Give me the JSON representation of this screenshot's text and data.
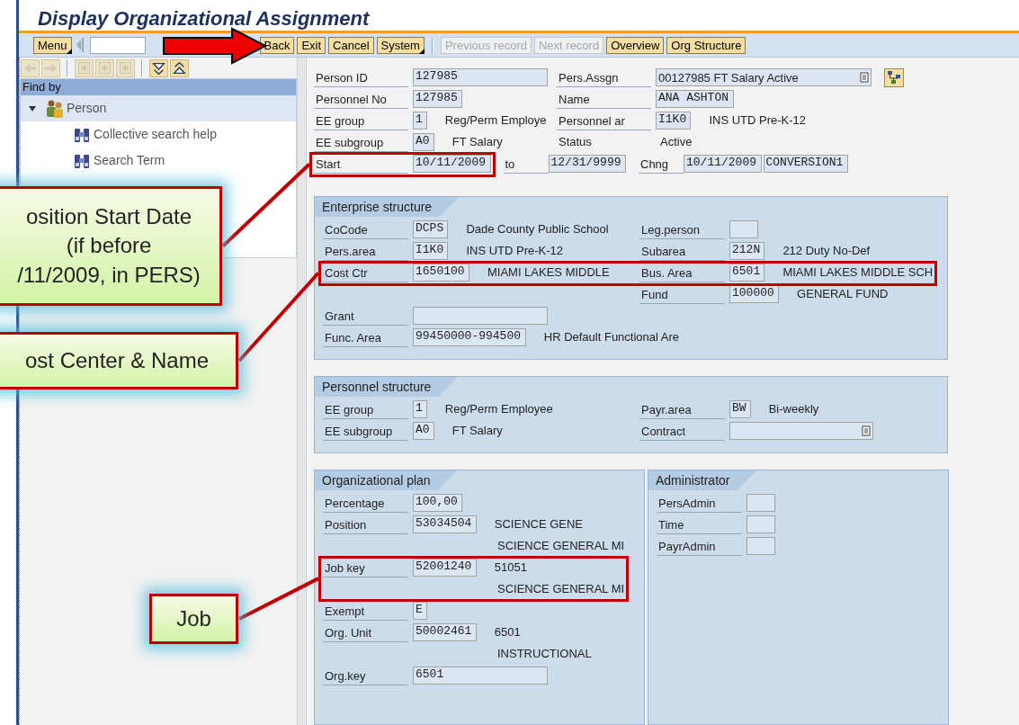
{
  "window": {
    "title": "Display Organizational Assignment"
  },
  "toolbar": {
    "menu": {
      "label": "Menu"
    },
    "button_groups": [
      [
        {
          "label": "Back",
          "kind": "button",
          "disabled": false
        },
        {
          "label": "Exit",
          "kind": "button",
          "disabled": false
        },
        {
          "label": "Cancel",
          "kind": "button",
          "disabled": false
        },
        {
          "label": "System",
          "kind": "menu",
          "disabled": false
        }
      ],
      [
        {
          "label": "Previous record",
          "kind": "button",
          "disabled": true
        },
        {
          "label": "Next record",
          "kind": "button",
          "disabled": true
        },
        {
          "label": "Overview",
          "kind": "button",
          "disabled": false
        },
        {
          "label": "Org Structure",
          "kind": "button",
          "disabled": false
        }
      ]
    ]
  },
  "nav_toolbar": [
    {
      "kind": "back",
      "disabled": true
    },
    {
      "kind": "forward",
      "disabled": true
    },
    {
      "kind": "grid",
      "disabled": true
    },
    {
      "kind": "grid",
      "disabled": true
    },
    {
      "kind": "grid",
      "disabled": true
    },
    {
      "kind": "expand",
      "disabled": false
    },
    {
      "kind": "collapse",
      "disabled": false
    }
  ],
  "find_by": {
    "header": "Find by",
    "items": [
      {
        "label": "Person",
        "expanded": true,
        "selected": true,
        "children": [
          {
            "label": "Collective search help",
            "selected": false
          },
          {
            "label": "Search Term",
            "selected": false
          }
        ]
      }
    ]
  },
  "header_rows": [
    {
      "left": [
        {
          "kind": "label",
          "text": "Person ID"
        },
        {
          "kind": "wide-field",
          "value": "127985"
        }
      ],
      "right": [
        {
          "kind": "label",
          "text": "Pers.Assgn"
        },
        {
          "kind": "dropdown",
          "value": "00127985 FT Salary Active"
        },
        {
          "kind": "org-button"
        }
      ]
    },
    {
      "left": [
        {
          "kind": "label",
          "text": "Personnel No"
        },
        {
          "kind": "field",
          "value": "127985"
        }
      ],
      "right": [
        {
          "kind": "label",
          "text": "Name"
        },
        {
          "kind": "field",
          "value": "ANA ASHTON"
        }
      ]
    },
    {
      "left": [
        {
          "kind": "label",
          "text": "EE group"
        },
        {
          "kind": "field",
          "value": "1"
        },
        {
          "kind": "text",
          "text": "Reg/Perm Employe"
        }
      ],
      "right": [
        {
          "kind": "label",
          "text": "Personnel ar"
        },
        {
          "kind": "field",
          "value": "I1K0"
        },
        {
          "kind": "text",
          "text": "INS UTD Pre-K-12"
        }
      ]
    },
    {
      "left": [
        {
          "kind": "label",
          "text": "EE subgroup"
        },
        {
          "kind": "field",
          "value": "A0"
        },
        {
          "kind": "text",
          "text": "FT Salary"
        }
      ],
      "right": [
        {
          "kind": "plain",
          "text": "Status"
        },
        {
          "kind": "text",
          "text": "Active"
        }
      ]
    },
    {
      "left": [
        {
          "kind": "label",
          "text": "Start",
          "highlighted": true
        },
        {
          "kind": "field",
          "value": "10/11/2009",
          "highlighted": true
        },
        {
          "kind": "short-label",
          "text": "to"
        },
        {
          "kind": "field",
          "value": "12/31/9999"
        }
      ],
      "right": [
        {
          "kind": "short-label",
          "text": "Chng"
        },
        {
          "kind": "field",
          "value": "10/11/2009"
        },
        {
          "kind": "field",
          "value": "CONVERSION1"
        }
      ]
    }
  ],
  "section_rows": [
    [
      {
        "title": "Enterprise structure",
        "rows": [
          {
            "left": [
              {
                "kind": "label",
                "text": "CoCode"
              },
              {
                "kind": "field",
                "value": "DCPS"
              },
              {
                "kind": "text",
                "text": "Dade County Public School"
              }
            ],
            "right": [
              {
                "kind": "label",
                "text": "Leg.person"
              },
              {
                "kind": "field"
              }
            ]
          },
          {
            "left": [
              {
                "kind": "label",
                "text": "Pers.area"
              },
              {
                "kind": "field",
                "value": "I1K0"
              },
              {
                "kind": "text",
                "text": "INS UTD Pre-K-12"
              }
            ],
            "right": [
              {
                "kind": "label",
                "text": "Subarea"
              },
              {
                "kind": "field",
                "value": "212N"
              },
              {
                "kind": "text",
                "text": "212 Duty No-Def"
              }
            ]
          },
          {
            "left": [
              {
                "kind": "label",
                "text": "Cost Ctr",
                "highlighted": true
              },
              {
                "kind": "field",
                "value": "1650100",
                "highlighted": true
              },
              {
                "kind": "text",
                "text": "MIAMI LAKES MIDDLE",
                "highlighted": true
              }
            ],
            "right": [
              {
                "kind": "label",
                "text": "Bus. Area",
                "highlighted": true
              },
              {
                "kind": "field",
                "value": "6501",
                "highlighted": true
              },
              {
                "kind": "text",
                "text": "MIAMI LAKES MIDDLE SCH",
                "highlighted": true
              }
            ]
          },
          {
            "right": [
              {
                "kind": "label",
                "text": "Fund"
              },
              {
                "kind": "field",
                "value": "100000"
              },
              {
                "kind": "text",
                "text": "GENERAL FUND"
              }
            ]
          },
          {
            "left": [
              {
                "kind": "label",
                "text": "Grant"
              },
              {
                "kind": "wide-field"
              }
            ]
          },
          {
            "left": [
              {
                "kind": "label",
                "text": "Func. Area"
              },
              {
                "kind": "field",
                "value": "99450000-994500"
              },
              {
                "kind": "text",
                "text": "HR Default Functional Are"
              }
            ]
          }
        ]
      }
    ],
    [
      {
        "title": "Personnel structure",
        "rows": [
          {
            "left": [
              {
                "kind": "label",
                "text": "EE group"
              },
              {
                "kind": "field",
                "value": "1"
              },
              {
                "kind": "text",
                "text": "Reg/Perm Employee"
              }
            ],
            "right": [
              {
                "kind": "label",
                "text": "Payr.area"
              },
              {
                "kind": "field",
                "value": "BW"
              },
              {
                "kind": "text",
                "text": "Bi-weekly"
              }
            ]
          },
          {
            "left": [
              {
                "kind": "label",
                "text": "EE subgroup"
              },
              {
                "kind": "field",
                "value": "A0"
              },
              {
                "kind": "text",
                "text": "FT Salary"
              }
            ],
            "right": [
              {
                "kind": "label",
                "text": "Contract"
              },
              {
                "kind": "dropdown"
              }
            ]
          }
        ]
      }
    ],
    [
      {
        "title": "Organizational plan",
        "rows": [
          {
            "left": [
              {
                "kind": "label",
                "text": "Percentage"
              },
              {
                "kind": "field",
                "value": "100,00"
              }
            ]
          },
          {
            "left": [
              {
                "kind": "label",
                "text": "Position"
              },
              {
                "kind": "field",
                "value": "53034504"
              },
              {
                "kind": "text",
                "text": "SCIENCE GENE"
              }
            ]
          },
          {
            "left": [
              {
                "kind": "text",
                "text": "SCIENCE GENERAL MI"
              }
            ]
          },
          {
            "left": [
              {
                "kind": "label",
                "text": "Job key",
                "highlighted": true
              },
              {
                "kind": "field",
                "value": "52001240",
                "highlighted": true
              },
              {
                "kind": "text",
                "text": "51051",
                "highlighted": true
              }
            ]
          },
          {
            "left": [
              {
                "kind": "text",
                "text": "SCIENCE GENERAL MI",
                "highlighted": true
              }
            ]
          },
          {
            "left": [
              {
                "kind": "label",
                "text": "Exempt"
              },
              {
                "kind": "field",
                "value": "E"
              }
            ]
          },
          {
            "left": [
              {
                "kind": "label",
                "text": "Org. Unit"
              },
              {
                "kind": "field",
                "value": "50002461"
              },
              {
                "kind": "text",
                "text": "6501"
              }
            ]
          },
          {
            "left": [
              {
                "kind": "text",
                "text": "INSTRUCTIONAL"
              }
            ]
          },
          {
            "left": [
              {
                "kind": "label",
                "text": "Org.key"
              },
              {
                "kind": "wide-field",
                "value": "6501"
              }
            ]
          }
        ]
      },
      {
        "title": "Administrator",
        "rows": [
          {
            "left": [
              {
                "kind": "label",
                "text": "PersAdmin"
              },
              {
                "kind": "field"
              }
            ]
          },
          {
            "left": [
              {
                "kind": "label",
                "text": "Time"
              },
              {
                "kind": "field"
              }
            ]
          },
          {
            "left": [
              {
                "kind": "label",
                "text": "PayrAdmin"
              },
              {
                "kind": "field"
              }
            ]
          }
        ]
      }
    ]
  ],
  "callouts": [
    {
      "lines": [
        "osition Start Date",
        "(if before",
        "/11/2009, in PERS)"
      ]
    },
    {
      "lines": [
        "ost Center & Name"
      ]
    },
    {
      "lines": [
        "Job"
      ]
    }
  ]
}
